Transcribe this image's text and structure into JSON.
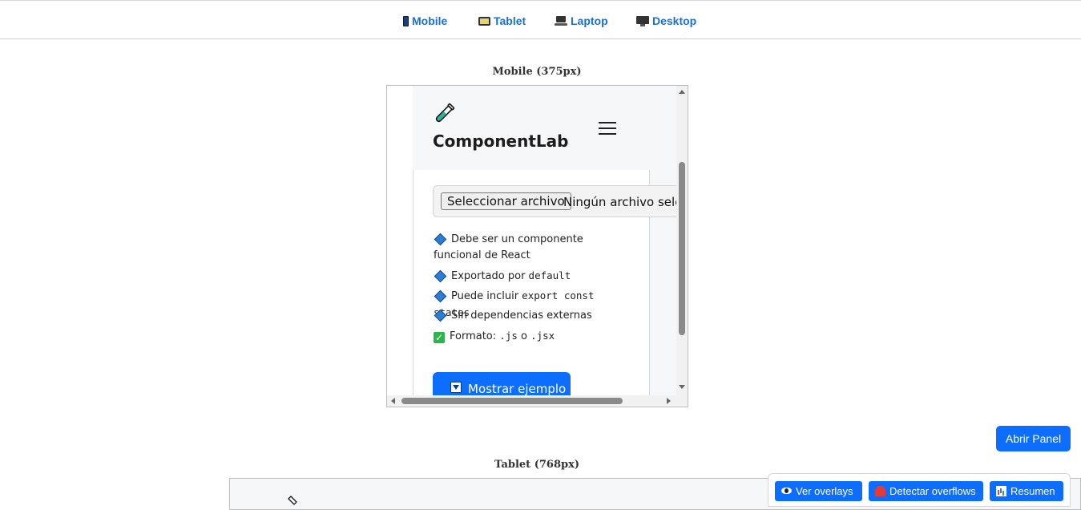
{
  "topnav": {
    "items": [
      {
        "label": "Mobile",
        "icon": "mobile-phone-icon"
      },
      {
        "label": "Tablet",
        "icon": "tablet-icon"
      },
      {
        "label": "Laptop",
        "icon": "laptop-icon"
      },
      {
        "label": "Desktop",
        "icon": "desktop-icon"
      }
    ],
    "link_color": "#1a6fd8"
  },
  "mobile": {
    "title": "Mobile (375px)",
    "preview": {
      "brand": "ComponentLab",
      "brand_icon": "test-tube-icon",
      "menu_icon": "hamburger-icon",
      "file_button": "Seleccionar archivo",
      "file_status": "Ningún archivo selec",
      "requirements": [
        {
          "text": "Debe ser un componente funcional de React"
        },
        {
          "text": "Exportado por ",
          "code": "default"
        },
        {
          "text": "Puede incluir ",
          "code": "export const states"
        },
        {
          "text": "Sin dependencias externas"
        }
      ],
      "format": {
        "prefix": "Formato: ",
        "code1": ".js",
        "mid": " o ",
        "code2": ".jsx"
      },
      "show_example": "Mostrar ejemplo"
    }
  },
  "tablet": {
    "title": "Tablet (768px)"
  },
  "panel": {
    "open_label": "Abrir Panel"
  },
  "tools": {
    "overlays": "Ver overlays",
    "overflows": "Detectar overflows",
    "summary": "Resumen"
  },
  "colors": {
    "primary": "#0d6efd",
    "card_bg": "#f6f7f9"
  }
}
